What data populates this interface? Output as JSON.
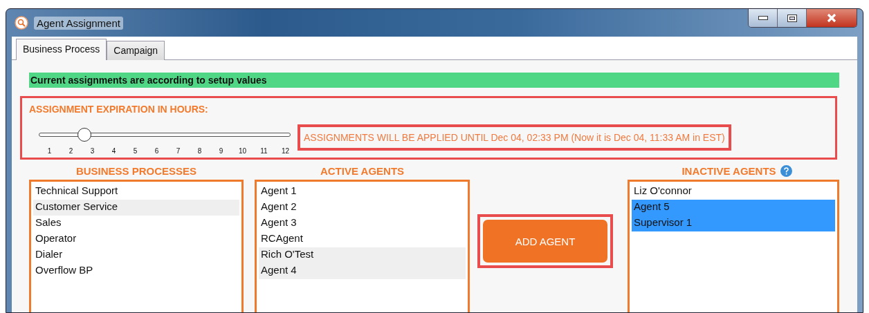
{
  "window": {
    "title": "Agent Assignment"
  },
  "tabs": [
    {
      "label": "Business Process",
      "selected": true
    },
    {
      "label": "Campaign",
      "selected": false
    }
  ],
  "status_banner": "Current assignments are according to setup values",
  "expiration": {
    "heading": "ASSIGNMENT EXPIRATION IN HOURS:",
    "level": 0.18,
    "ticks": [
      "1",
      "2",
      "3",
      "4",
      "5",
      "6",
      "7",
      "8",
      "9",
      "10",
      "11",
      "12"
    ],
    "message": "ASSIGNMENTS WILL BE APPLIED UNTIL Dec 04, 02:33 PM (Now it is Dec 04, 11:33 AM in EST)"
  },
  "business_processes": {
    "heading": "BUSINESS PROCESSES",
    "focused": false,
    "items": [
      {
        "label": "Technical Support",
        "selected": false
      },
      {
        "label": "Customer Service",
        "selected": true
      },
      {
        "label": "Sales",
        "selected": false
      },
      {
        "label": "Operator",
        "selected": false
      },
      {
        "label": "Dialer",
        "selected": false
      },
      {
        "label": "Overflow BP",
        "selected": false
      }
    ]
  },
  "active_agents": {
    "heading": "ACTIVE AGENTS",
    "focused": false,
    "items": [
      {
        "label": "Agent 1",
        "selected": false
      },
      {
        "label": "Agent 2",
        "selected": false
      },
      {
        "label": "Agent 3",
        "selected": false
      },
      {
        "label": "RCAgent",
        "selected": false
      },
      {
        "label": "Rich O'Test",
        "selected": true
      },
      {
        "label": "Agent 4",
        "selected": true
      }
    ]
  },
  "add_button": "ADD AGENT",
  "inactive_agents": {
    "heading": "INACTIVE AGENTS",
    "focused": true,
    "items": [
      {
        "label": "Liz O'connor",
        "selected": false
      },
      {
        "label": "Agent 5",
        "selected": true
      },
      {
        "label": "Supervisor 1",
        "selected": true
      }
    ]
  }
}
